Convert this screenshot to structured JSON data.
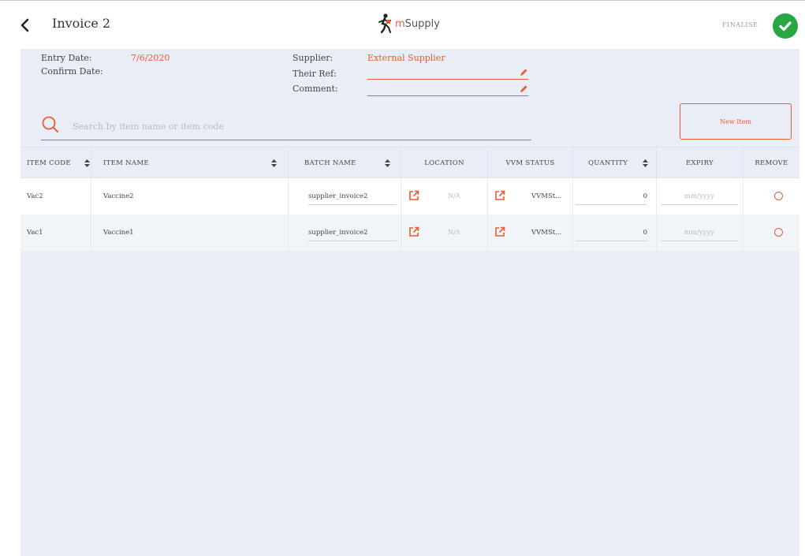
{
  "header": {
    "back_icon": "chevron-left-icon",
    "title": "Invoice 2",
    "brand_m": "m",
    "brand_rest": "Supply",
    "finalise_label": "FINALISE",
    "finalise_icon": "check-circle-icon",
    "accent_color": "#e95c30",
    "finalise_color": "#27a844"
  },
  "info": {
    "entry_date_label": "Entry Date:",
    "entry_date_value": "7/6/2020",
    "confirm_date_label": "Confirm Date:",
    "supplier_label": "Supplier:",
    "supplier_value": "External Supplier",
    "their_ref_label": "Their Ref:",
    "their_ref_value": "",
    "comment_label": "Comment:",
    "comment_value": ""
  },
  "search": {
    "placeholder": "Search by item name or item code",
    "value": ""
  },
  "new_item_label": "New Item",
  "table": {
    "columns": {
      "item_code": "ITEM CODE",
      "item_name": "ITEM NAME",
      "batch_name": "BATCH NAME",
      "location": "LOCATION",
      "vvm_status": "VVM STATUS",
      "quantity": "QUANTITY",
      "expiry": "EXPIRY",
      "remove": "REMOVE"
    },
    "rows": [
      {
        "item_code": "Vac2",
        "item_name": "Vaccine2",
        "batch_name": "supplier_invoice2",
        "location": "N/A",
        "vvm_status": "VVMSt...",
        "quantity": "0",
        "expiry_placeholder": "mm/yyyy"
      },
      {
        "item_code": "Vac1",
        "item_name": "Vaccine1",
        "batch_name": "supplier_invoice2",
        "location": "N/A",
        "vvm_status": "VVMSt...",
        "quantity": "0",
        "expiry_placeholder": "mm/yyyy"
      }
    ]
  }
}
